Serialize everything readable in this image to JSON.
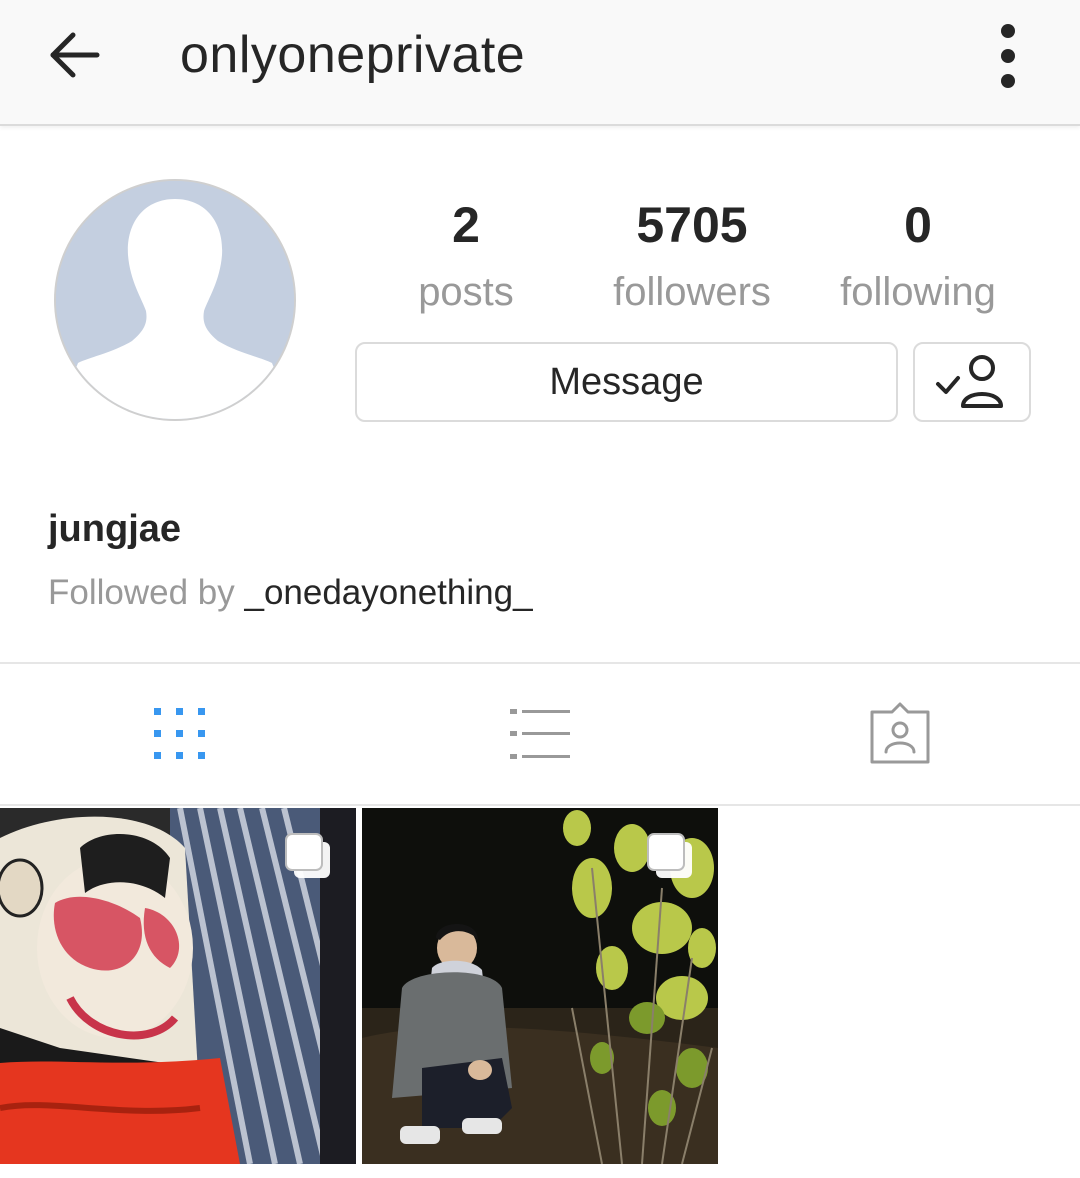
{
  "header": {
    "title": "onlyoneprivate",
    "back_icon": "arrow-left-icon",
    "more_icon": "vertical-dots-icon"
  },
  "profile": {
    "avatar_icon": "default-avatar-silhouette",
    "stats": {
      "posts": {
        "count": "2",
        "label": "posts"
      },
      "followers": {
        "count": "5705",
        "label": "followers"
      },
      "following": {
        "count": "0",
        "label": "following"
      }
    },
    "message_label": "Message",
    "following_icon": "user-check-icon",
    "display_name": "jungjae",
    "followed_by_prefix": "Followed by ",
    "followed_by_user": "_onedayonething_"
  },
  "tabs": [
    {
      "icon": "grid-icon",
      "active": true
    },
    {
      "icon": "list-icon",
      "active": false
    },
    {
      "icon": "tagged-icon",
      "active": false
    }
  ],
  "posts": [
    {
      "multiple": true,
      "icon": "multiple-photos-icon"
    },
    {
      "multiple": true,
      "icon": "multiple-photos-icon"
    }
  ],
  "colors": {
    "accent": "#3897f0",
    "text_primary": "#262626",
    "text_secondary": "#999999",
    "border": "#dbdbdb",
    "avatar_bg": "#c4cfe0"
  }
}
